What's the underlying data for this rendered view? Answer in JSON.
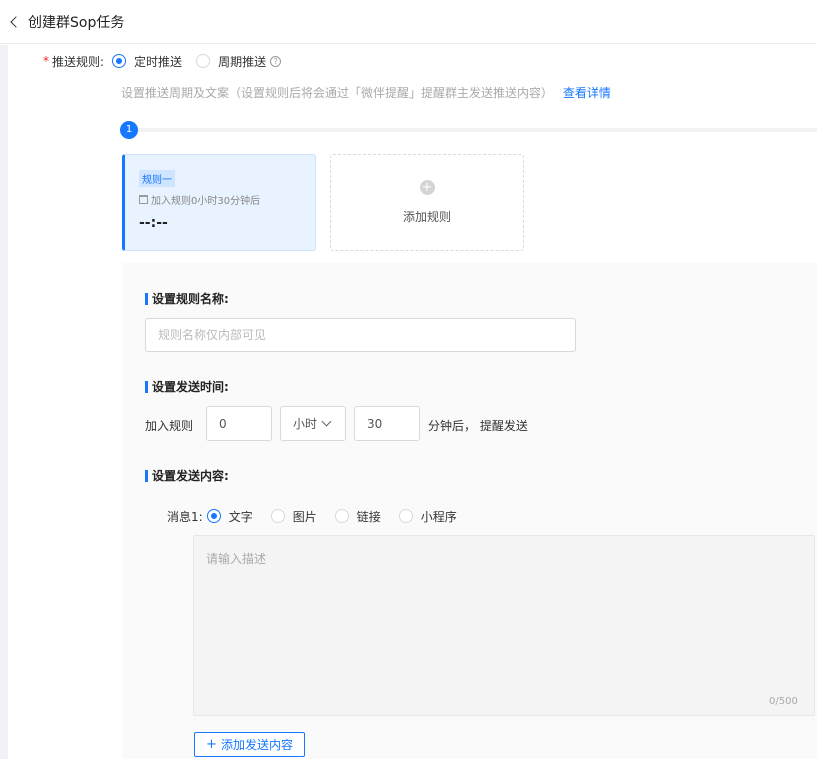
{
  "header": {
    "title": "创建群Sop任务"
  },
  "push_rule": {
    "required_mark": "*",
    "label": "推送规则:",
    "options": [
      {
        "label": "定时推送",
        "selected": true
      },
      {
        "label": "周期推送",
        "selected": false
      }
    ],
    "help_icon": "?"
  },
  "description": {
    "text": "设置推送周期及文案（设置规则后将会通过「微伴提醒」提醒群主发送推送内容）",
    "link": "查看详情"
  },
  "step": {
    "number": "1"
  },
  "rule_card": {
    "tag": "规则一",
    "subtitle": "加入规则0小时30分钟后",
    "time": "--:--"
  },
  "add_rule": {
    "plus": "+",
    "label": "添加规则"
  },
  "sections": {
    "name": {
      "title": "设置规则名称:",
      "placeholder": "规则名称仅内部可见"
    },
    "send_time": {
      "title": "设置发送时间:",
      "prefix": "加入规则",
      "hours_value": "0",
      "unit": "小时",
      "minutes_value": "30",
      "suffix": "分钟后， 提醒发送"
    },
    "content": {
      "title": "设置发送内容:",
      "message_label": "消息1:",
      "types": [
        {
          "label": "文字",
          "selected": true
        },
        {
          "label": "图片",
          "selected": false
        },
        {
          "label": "链接",
          "selected": false
        },
        {
          "label": "小程序",
          "selected": false
        }
      ],
      "placeholder": "请输入描述",
      "counter": "0/500",
      "add_button": "添加发送内容",
      "add_button_plus": "+"
    }
  },
  "colors": {
    "accent": "#1677ff",
    "required": "#f5222d",
    "card_bg": "#e8f3ff",
    "panel_bg": "#fafafa"
  }
}
